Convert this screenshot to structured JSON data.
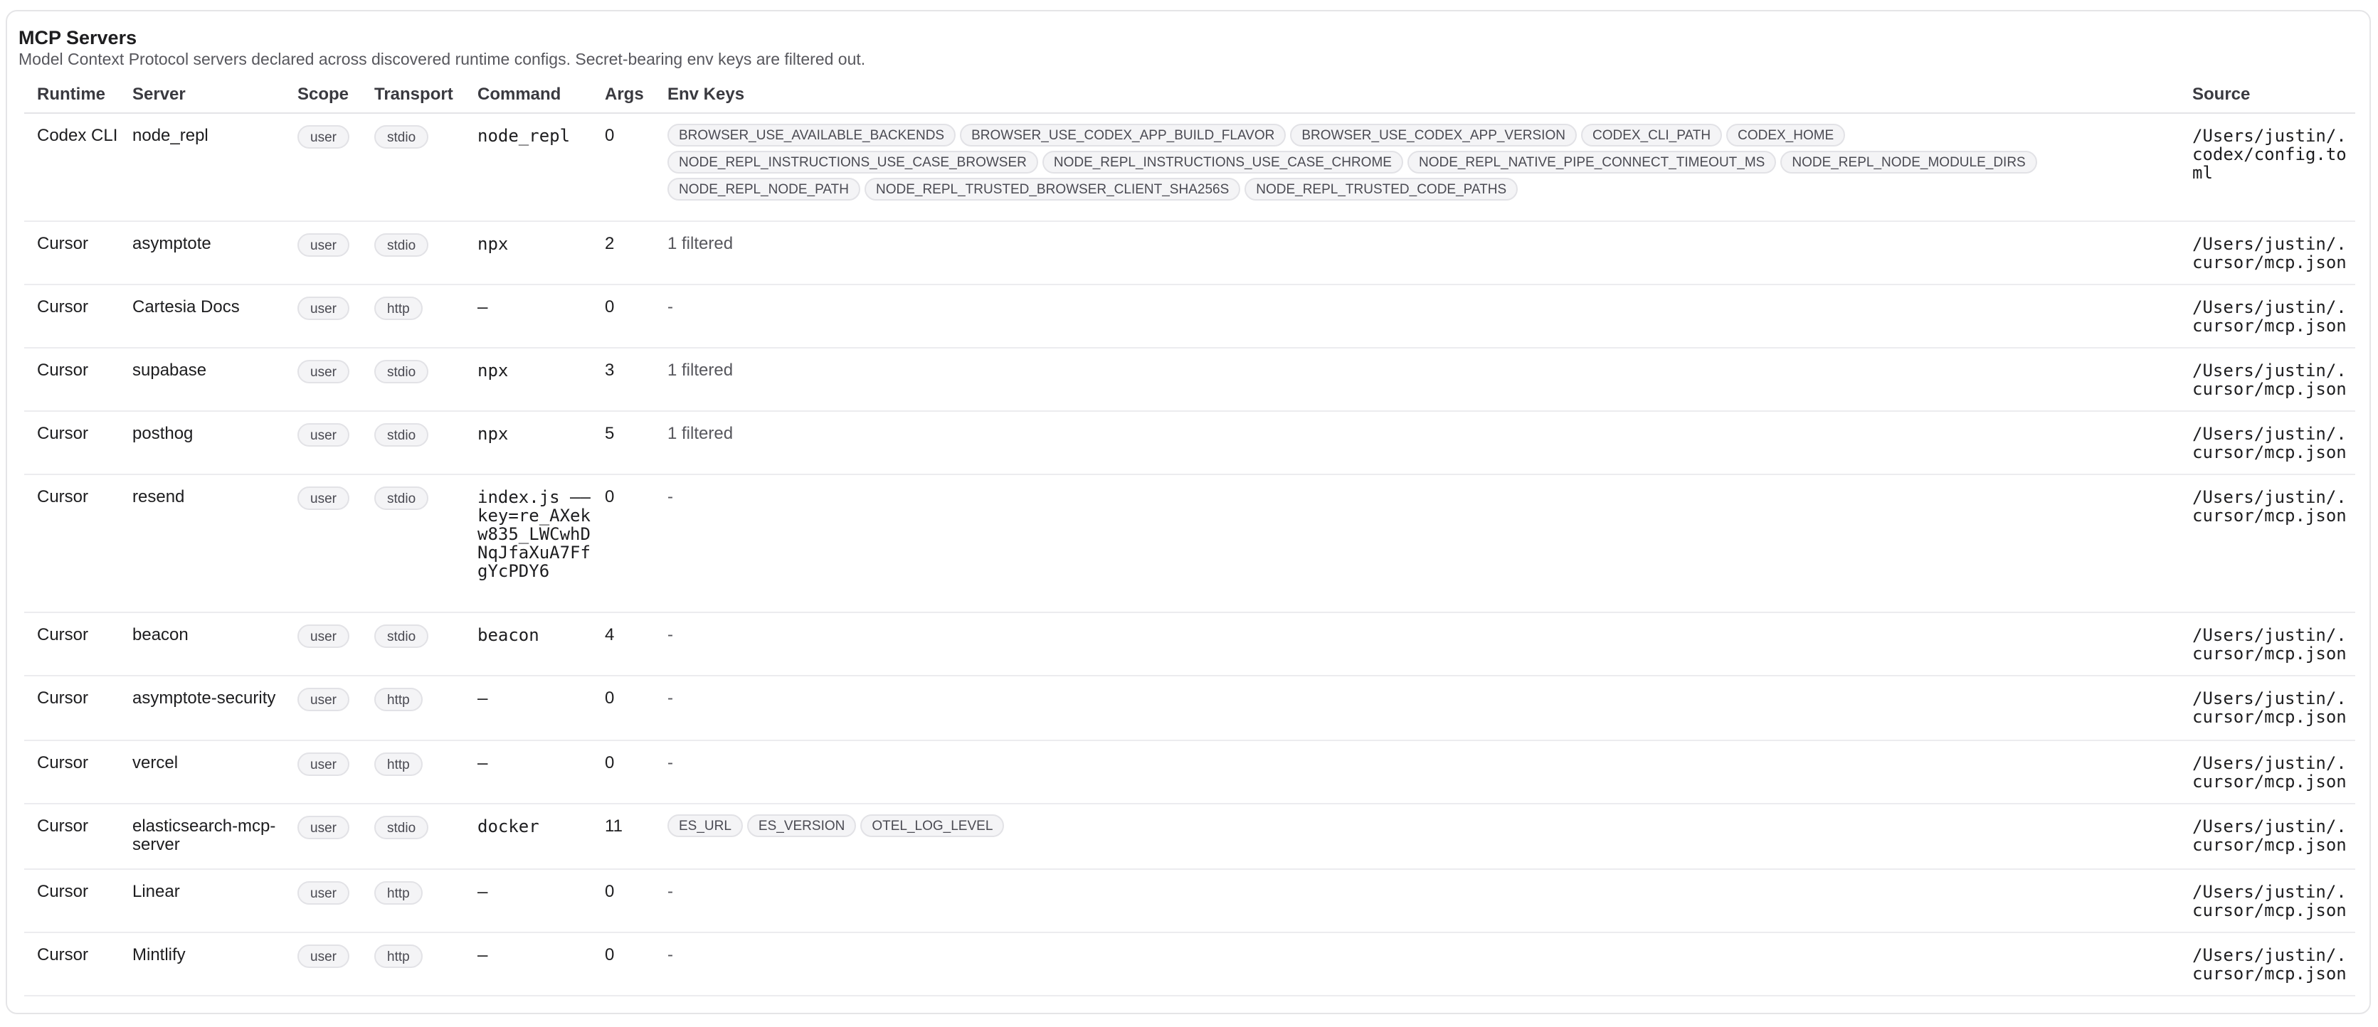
{
  "section": {
    "title": "MCP Servers",
    "subtitle": "Model Context Protocol servers declared across discovered runtime configs. Secret-bearing env keys are filtered out."
  },
  "table": {
    "headers": {
      "runtime": "Runtime",
      "server": "Server",
      "scope": "Scope",
      "transport": "Transport",
      "command": "Command",
      "args": "Args",
      "env_keys": "Env Keys",
      "source": "Source"
    },
    "rows": [
      {
        "runtime": "Codex CLI",
        "server": "node_repl",
        "scope": "user",
        "transport": "stdio",
        "command": "node_repl",
        "args": "0",
        "env_text": "",
        "env_keys": [
          "BROWSER_USE_AVAILABLE_BACKENDS",
          "BROWSER_USE_CODEX_APP_BUILD_FLAVOR",
          "BROWSER_USE_CODEX_APP_VERSION",
          "CODEX_CLI_PATH",
          "CODEX_HOME",
          "NODE_REPL_INSTRUCTIONS_USE_CASE_BROWSER",
          "NODE_REPL_INSTRUCTIONS_USE_CASE_CHROME",
          "NODE_REPL_NATIVE_PIPE_CONNECT_TIMEOUT_MS",
          "NODE_REPL_NODE_MODULE_DIRS",
          "NODE_REPL_NODE_PATH",
          "NODE_REPL_TRUSTED_BROWSER_CLIENT_SHA256S",
          "NODE_REPL_TRUSTED_CODE_PATHS"
        ],
        "source": "/Users/justin/.codex/config.toml"
      },
      {
        "runtime": "Cursor",
        "server": "asymptote",
        "scope": "user",
        "transport": "stdio",
        "command": "npx",
        "args": "2",
        "env_text": "1 filtered",
        "env_keys": [],
        "source": "/Users/justin/.cursor/mcp.json"
      },
      {
        "runtime": "Cursor",
        "server": "Cartesia Docs",
        "scope": "user",
        "transport": "http",
        "command": "–",
        "args": "0",
        "env_text": "-",
        "env_keys": [],
        "source": "/Users/justin/.cursor/mcp.json"
      },
      {
        "runtime": "Cursor",
        "server": "supabase",
        "scope": "user",
        "transport": "stdio",
        "command": "npx",
        "args": "3",
        "env_text": "1 filtered",
        "env_keys": [],
        "source": "/Users/justin/.cursor/mcp.json"
      },
      {
        "runtime": "Cursor",
        "server": "posthog",
        "scope": "user",
        "transport": "stdio",
        "command": "npx",
        "args": "5",
        "env_text": "1 filtered",
        "env_keys": [],
        "source": "/Users/justin/.cursor/mcp.json"
      },
      {
        "runtime": "Cursor",
        "server": "resend",
        "scope": "user",
        "transport": "stdio",
        "command": "index.js ––key=re_AXekw835_LWCwhDNqJfaXuA7FfgYcPDY6",
        "args": "0",
        "env_text": "-",
        "env_keys": [],
        "source": "/Users/justin/.cursor/mcp.json"
      },
      {
        "runtime": "Cursor",
        "server": "beacon",
        "scope": "user",
        "transport": "stdio",
        "command": "beacon",
        "args": "4",
        "env_text": "-",
        "env_keys": [],
        "source": "/Users/justin/.cursor/mcp.json"
      },
      {
        "runtime": "Cursor",
        "server": "asymptote-security",
        "scope": "user",
        "transport": "http",
        "command": "–",
        "args": "0",
        "env_text": "-",
        "env_keys": [],
        "source": "/Users/justin/.cursor/mcp.json"
      },
      {
        "runtime": "Cursor",
        "server": "vercel",
        "scope": "user",
        "transport": "http",
        "command": "–",
        "args": "0",
        "env_text": "-",
        "env_keys": [],
        "source": "/Users/justin/.cursor/mcp.json"
      },
      {
        "runtime": "Cursor",
        "server": "elasticsearch-mcp-server",
        "scope": "user",
        "transport": "stdio",
        "command": "docker",
        "args": "11",
        "env_text": "",
        "env_keys": [
          "ES_URL",
          "ES_VERSION",
          "OTEL_LOG_LEVEL"
        ],
        "source": "/Users/justin/.cursor/mcp.json"
      },
      {
        "runtime": "Cursor",
        "server": "Linear",
        "scope": "user",
        "transport": "http",
        "command": "–",
        "args": "0",
        "env_text": "-",
        "env_keys": [],
        "source": "/Users/justin/.cursor/mcp.json"
      },
      {
        "runtime": "Cursor",
        "server": "Mintlify",
        "scope": "user",
        "transport": "http",
        "command": "–",
        "args": "0",
        "env_text": "-",
        "env_keys": [],
        "source": "/Users/justin/.cursor/mcp.json"
      }
    ]
  }
}
